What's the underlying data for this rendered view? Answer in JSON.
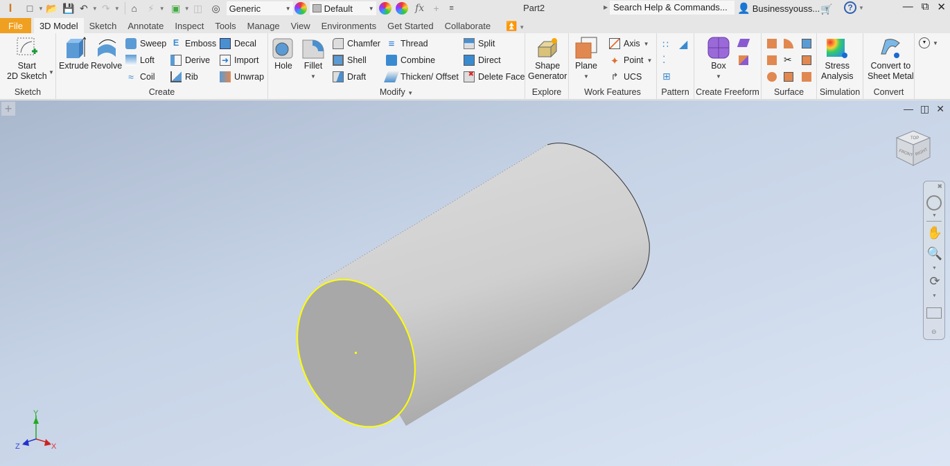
{
  "app": {
    "title": "Part2",
    "logo": "inventor-logo-icon"
  },
  "quick_access": {
    "items": [
      "new-icon",
      "open-icon",
      "save-icon",
      "undo-icon",
      "redo-icon",
      "home-icon",
      "update-icon",
      "select-icon",
      "shadow-icon",
      "appearance-icon"
    ],
    "material": "Generic",
    "appearance": "Default",
    "formula_label": "fx"
  },
  "search": {
    "placeholder": "Search Help & Commands..."
  },
  "user": {
    "name": "Businessyouss..."
  },
  "tabs": [
    {
      "label": "File"
    },
    {
      "label": "3D Model"
    },
    {
      "label": "Sketch"
    },
    {
      "label": "Annotate"
    },
    {
      "label": "Inspect"
    },
    {
      "label": "Tools"
    },
    {
      "label": "Manage"
    },
    {
      "label": "View"
    },
    {
      "label": "Environments"
    },
    {
      "label": "Get Started"
    },
    {
      "label": "Collaborate"
    }
  ],
  "active_tab": "3D Model",
  "ribbon": {
    "sketch": {
      "title": "Sketch",
      "start_sketch": "Start\n2D Sketch"
    },
    "create": {
      "title": "Create",
      "extrude": "Extrude",
      "revolve": "Revolve",
      "sweep": "Sweep",
      "loft": "Loft",
      "coil": "Coil",
      "emboss": "Emboss",
      "derive": "Derive",
      "rib": "Rib",
      "decal": "Decal",
      "import": "Import",
      "unwrap": "Unwrap"
    },
    "modify": {
      "title": "Modify",
      "hole": "Hole",
      "fillet": "Fillet",
      "chamfer": "Chamfer",
      "shell": "Shell",
      "draft": "Draft",
      "thread": "Thread",
      "combine": "Combine",
      "thicken": "Thicken/ Offset",
      "split": "Split",
      "direct": "Direct",
      "delete_face": "Delete Face"
    },
    "explore": {
      "title": "Explore",
      "shape_gen_1": "Shape",
      "shape_gen_2": "Generator"
    },
    "work": {
      "title": "Work Features",
      "plane": "Plane",
      "axis": "Axis",
      "point": "Point",
      "ucs": "UCS"
    },
    "pattern": {
      "title": "Pattern"
    },
    "freeform": {
      "title": "Create Freeform",
      "box": "Box"
    },
    "surface": {
      "title": "Surface"
    },
    "simulation": {
      "title": "Simulation",
      "stress_1": "Stress",
      "stress_2": "Analysis"
    },
    "convert": {
      "title": "Convert",
      "c1": "Convert to",
      "c2": "Sheet Metal"
    }
  },
  "viewcube": {
    "top": "TOP",
    "front": "FRONT",
    "right": "RIGHT"
  },
  "triad": {
    "x": "X",
    "y": "Y",
    "z": "Z"
  },
  "colors": {
    "file_tab": "#f0a020",
    "selection": "#ffff00",
    "x_axis": "#cc2222",
    "y_axis": "#22aa22",
    "z_axis": "#2233cc"
  }
}
